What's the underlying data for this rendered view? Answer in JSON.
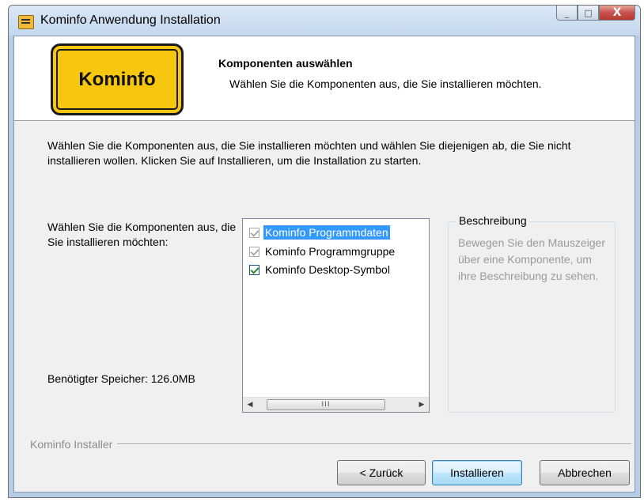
{
  "window": {
    "title": "Kominfo Anwendung Installation",
    "controls": {
      "minimize": "_",
      "maximize": "□",
      "close": "X"
    }
  },
  "header": {
    "logo_text": "Kominfo",
    "title": "Komponenten auswählen",
    "subtitle": "Wählen Sie die Komponenten aus, die Sie installieren möchten."
  },
  "intro": "Wählen Sie die Komponenten aus, die Sie installieren möchten und wählen Sie diejenigen ab, die Sie nicht installieren wollen. Klicken Sie auf Installieren, um die Installation zu starten.",
  "components": {
    "label": "Wählen Sie die Komponenten aus, die Sie installieren möchten:",
    "items": [
      {
        "label": "Kominfo Programmdaten",
        "checked": true,
        "enabled": false,
        "selected": true
      },
      {
        "label": "Kominfo Programmgruppe",
        "checked": true,
        "enabled": false,
        "selected": false
      },
      {
        "label": "Kominfo Desktop-Symbol",
        "checked": true,
        "enabled": true,
        "selected": false
      }
    ],
    "scroll_thumb": "III"
  },
  "space_required": "Benötigter Speicher: 126.0MB",
  "description": {
    "legend": "Beschreibung",
    "text": "Bewegen Sie den Mauszeiger über eine Komponente, um ihre Beschreibung zu sehen."
  },
  "footer": {
    "branding": "Kominfo Installer",
    "back_label": "< Zurück",
    "install_label": "Installieren",
    "cancel_label": "Abbrechen"
  },
  "colors": {
    "selection": "#3399ff",
    "logo_yellow": "#f7c60f",
    "close_red": "#c75050"
  }
}
